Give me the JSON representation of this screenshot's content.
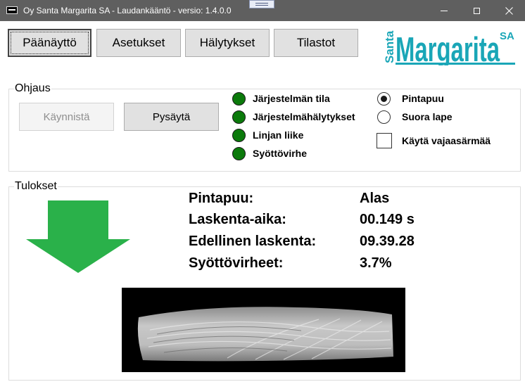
{
  "window": {
    "title": "Oy Santa Margarita SA - Laudankääntö - versio: 1.4.0.0",
    "controls": [
      "minimize-icon",
      "maximize-icon",
      "close-icon"
    ]
  },
  "nav": {
    "main": "Päänäyttö",
    "settings": "Asetukset",
    "alarms": "Hälytykset",
    "stats": "Tilastot"
  },
  "logo": {
    "small": "Santa",
    "big": "Margarita",
    "suffix": "SA",
    "color": "#1aa6b7"
  },
  "ohjaus": {
    "title": "Ohjaus",
    "start_label": "Käynnistä",
    "stop_label": "Pysäytä",
    "status": [
      {
        "label": "Järjestelmän tila",
        "color": "#0b7a0b"
      },
      {
        "label": "Järjestelmähälytykset",
        "color": "#0b7a0b"
      },
      {
        "label": "Linjan liike",
        "color": "#0b7a0b"
      },
      {
        "label": "Syöttövirhe",
        "color": "#0b7a0b"
      }
    ],
    "radio_pintapuu": "Pintapuu",
    "radio_suora": "Suora lape",
    "checkbox_label": "Käytä vajaasärmää"
  },
  "tulokset": {
    "title": "Tulokset",
    "arrow_color": "#2ab14a",
    "rows": [
      {
        "label": "Pintapuu:",
        "value": "Alas"
      },
      {
        "label": "Laskenta-aika:",
        "value": "00.149 s"
      },
      {
        "label": "Edellinen laskenta:",
        "value": "09.39.28"
      },
      {
        "label": "Syöttövirheet:",
        "value": "3.7%"
      }
    ]
  }
}
